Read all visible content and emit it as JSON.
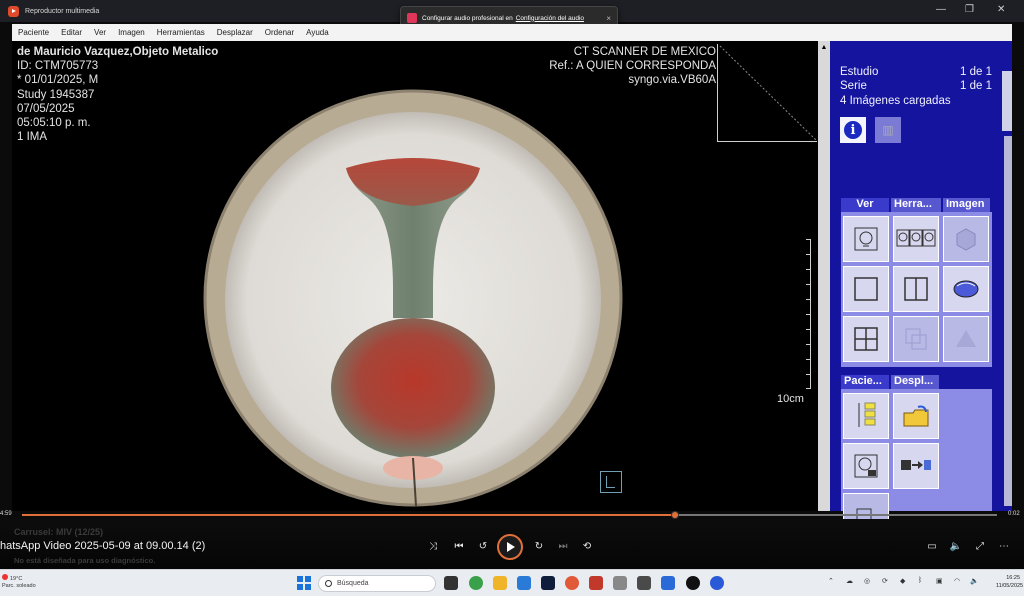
{
  "window": {
    "title": "Reproductor multimedia"
  },
  "toast": {
    "text": "Configurar audio profesional en",
    "link": "Configuración del audio"
  },
  "menubar": {
    "items": [
      "Paciente",
      "Editar",
      "Ver",
      "Imagen",
      "Herramientas",
      "Desplazar",
      "Ordenar",
      "Ayuda"
    ]
  },
  "overlay": {
    "left_lines": [
      "de Mauricio Vazquez,Objeto Metalico",
      "ID: CTM705773",
      "* 01/01/2025, M",
      "Study 1945387",
      "07/05/2025",
      "05:05:10 p. m.",
      "1 IMA"
    ],
    "right_lines": [
      "CT SCANNER DE MEXICO",
      "Ref.: A QUIEN  CORRESPONDA",
      "syngo.via.VB60A"
    ],
    "scale_label": "10cm"
  },
  "panel": {
    "estudio_label": "Estudio",
    "estudio_value": "1 de 1",
    "serie_label": "Serie",
    "serie_value": "1 de 1",
    "loaded": "4 Imágenes cargadas",
    "tabs_top": [
      "Ver",
      "Herra...",
      "Imagen"
    ],
    "tabs_bottom": [
      "Pacie...",
      "Despl..."
    ],
    "accent": "#14149e"
  },
  "player": {
    "elapsed": "4:59",
    "remaining": "0:02",
    "progress": 0.67,
    "video_title": "hatsApp Video 2025-05-09 at 09.00.14 (2)",
    "ghost_title": "Carrusel: MIV (12/25)",
    "ghost_note": "No está diseñada para uso diagnóstico."
  },
  "taskbar": {
    "weather_temp": "19°C",
    "weather_desc": "Parc. soleado",
    "search_placeholder": "Búsqueda",
    "time": "16:25",
    "date": "11/05/2025"
  }
}
